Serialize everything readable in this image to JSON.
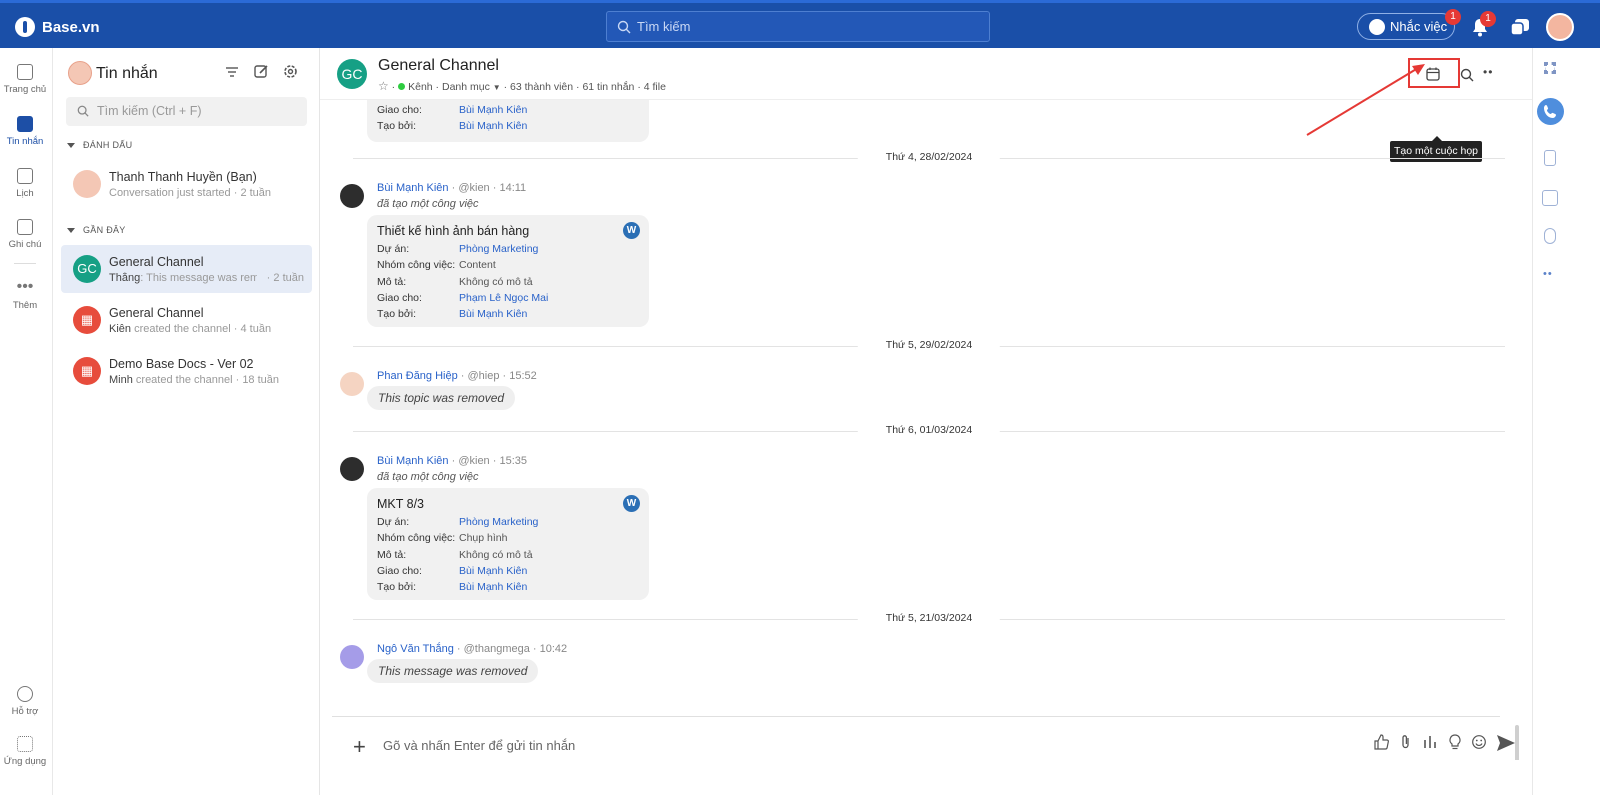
{
  "topbar": {
    "brand": "Base.vn",
    "search_placeholder": "Tìm kiếm",
    "remind_label": "Nhắc việc",
    "remind_badge": "1",
    "notif_badge": "1",
    "accent": "#1a4fa8"
  },
  "leftnav": {
    "items": [
      {
        "label": "Trang chủ",
        "icon": "home-icon"
      },
      {
        "label": "Tin nhắn",
        "icon": "chat-icon"
      },
      {
        "label": "Lịch",
        "icon": "calendar-icon"
      },
      {
        "label": "Ghi chú",
        "icon": "note-icon"
      },
      {
        "label": "Thêm",
        "icon": "more-icon"
      }
    ],
    "bottom": [
      {
        "label": "Hỗ trợ",
        "icon": "help-icon"
      },
      {
        "label": "Ứng dụng",
        "icon": "apps-icon"
      }
    ]
  },
  "sidebar": {
    "title": "Tin nhắn",
    "search_placeholder": "Tìm kiếm (Ctrl + F)",
    "section_marked": "ĐÁNH DẤU",
    "section_recent": "GẦN ĐÂY",
    "marked": [
      {
        "name": "Thanh Thanh Huyền (Bạn)",
        "sub": "Conversation just started",
        "time": "2 tuần"
      }
    ],
    "recent": [
      {
        "initials": "GC",
        "name": "General Channel",
        "sender": "Thắng",
        "sub": ": This message was rem...",
        "time": "2 tuần"
      },
      {
        "initials": "",
        "name": "General Channel",
        "sender": "Kiên",
        "sub": " created the channel",
        "time": "4 tuần"
      },
      {
        "initials": "",
        "name": "Demo Base Docs - Ver 02",
        "sender": "Minh",
        "sub": " created the channel",
        "time": "18 tuần"
      }
    ]
  },
  "channel": {
    "initials": "GC",
    "name": "General Channel",
    "type": "Kênh",
    "category": "Danh mục",
    "members": "63 thành viên",
    "messages": "61 tin nhắn",
    "files": "4 file",
    "tooltip": "Tạo một cuộc họp"
  },
  "messages": {
    "top_partial": {
      "rows": [
        {
          "k": "Giao cho:",
          "v": "Bùi Mạnh Kiên"
        },
        {
          "k": "Tạo bởi:",
          "v": "Bùi Mạnh Kiên"
        }
      ]
    },
    "dates": [
      "Thứ 4, 28/02/2024",
      "Thứ 5, 29/02/2024",
      "Thứ 6, 01/03/2024",
      "Thứ 5, 21/03/2024"
    ],
    "m1": {
      "name": "Bùi Mạnh Kiên",
      "handle": "@kien",
      "time": "14:11",
      "action": "đã tạo một công việc",
      "card_title": "Thiết kế hình ảnh bán hàng",
      "rows": [
        {
          "k": "Dự án:",
          "v": "Phòng Marketing"
        },
        {
          "k": "Nhóm công việc:",
          "v": "Content"
        },
        {
          "k": "Mô tả:",
          "v": "Không có mô tả"
        },
        {
          "k": "Giao cho:",
          "v": "Phạm Lê Ngọc Mai"
        },
        {
          "k": "Tạo bởi:",
          "v": "Bùi Mạnh Kiên"
        }
      ]
    },
    "m2": {
      "name": "Phan Đăng Hiệp",
      "handle": "@hiep",
      "time": "15:52",
      "text": "This topic was removed"
    },
    "m3": {
      "name": "Bùi Mạnh Kiên",
      "handle": "@kien",
      "time": "15:35",
      "action": "đã tạo một công việc",
      "card_title": "MKT 8/3",
      "rows": [
        {
          "k": "Dự án:",
          "v": "Phòng Marketing"
        },
        {
          "k": "Nhóm công việc:",
          "v": "Chụp hình"
        },
        {
          "k": "Mô tả:",
          "v": "Không có mô tả"
        },
        {
          "k": "Giao cho:",
          "v": "Bùi Mạnh Kiên"
        },
        {
          "k": "Tạo bởi:",
          "v": "Bùi Mạnh Kiên"
        }
      ]
    },
    "m4": {
      "name": "Ngô Văn Thắng",
      "handle": "@thangmega",
      "time": "10:42",
      "text": "This message was removed"
    },
    "w_logo": "W"
  },
  "composer": {
    "placeholder": "Gõ và nhấn Enter để gửi tin nhắn"
  }
}
